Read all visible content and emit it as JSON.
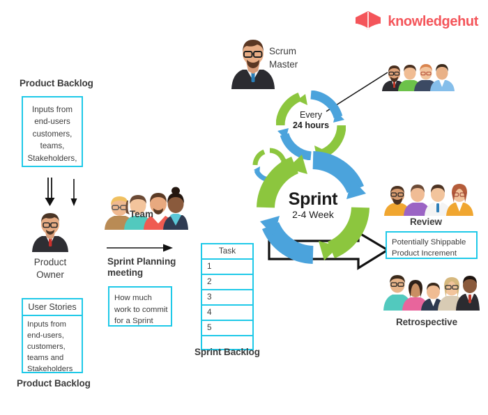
{
  "brand": {
    "name": "knowledgehut",
    "logo_icon": "open-book-shield-icon",
    "color": "#F4555A"
  },
  "diagram": {
    "title": "Scrum Framework Process",
    "colors": {
      "cyan_border": "#1EC9E8",
      "green_arrow": "#8CC63E",
      "blue_arrow": "#4BA3DC",
      "text": "#3b3b3b",
      "outline_arrow": "#1a1a1a"
    }
  },
  "left": {
    "product_backlog_heading": "Product Backlog",
    "product_backlog_inputs": "Inputs from end-users customers, teams, Stakeholders,",
    "product_owner_label": "Product\nOwner",
    "product_owner_line1": "Product",
    "product_owner_line2": "Owner",
    "user_stories_heading": "User Stories",
    "user_stories_inputs": "Inputs from end-users, customers, teams and Stakeholders",
    "product_backlog_caption": "Product Backlog"
  },
  "middle": {
    "team_label": "Team",
    "sprint_planning_line1": "Sprint Planning",
    "sprint_planning_line2": "meeting",
    "how_much_work": "How much work to commit for a Sprint",
    "sprint_backlog_caption": "Sprint Backlog",
    "task_table": {
      "header": "Task",
      "rows": [
        "1",
        "2",
        "3",
        "4",
        "5",
        ""
      ]
    }
  },
  "center": {
    "scrum_master_line1": "Scrum",
    "scrum_master_line2": "Master",
    "daily_cycle_line1": "Every",
    "daily_cycle_line2": "24 hours",
    "sprint_title": "Sprint",
    "sprint_duration": "2-4 Week"
  },
  "right": {
    "review_label": "Review",
    "increment_text": "Potentially Shippable Product Increment",
    "retrospective_label": "Retrospective"
  }
}
